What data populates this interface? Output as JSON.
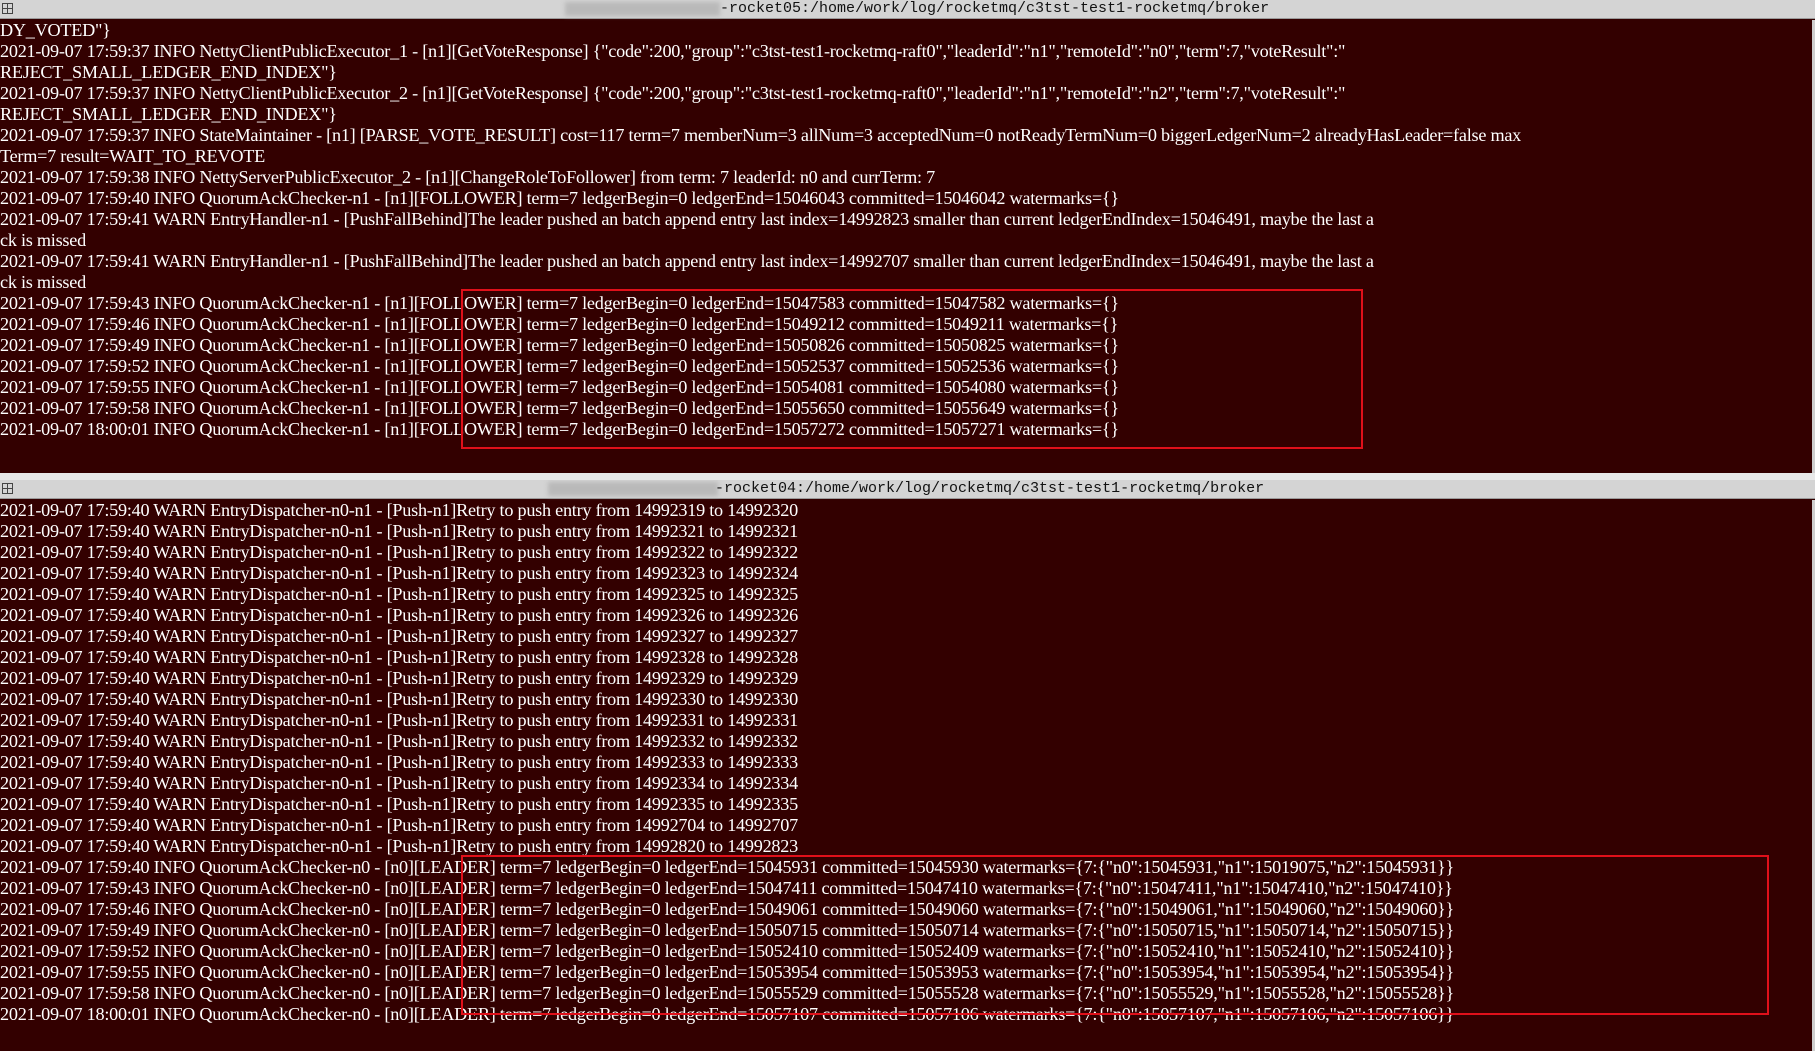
{
  "colors": {
    "background": "#330000",
    "text": "#ffffff",
    "highlight": "#e0101a"
  },
  "top_window": {
    "title_suffix": "-rocket05:/home/work/log/rocketmq/c3tst-test1-rocketmq/broker",
    "lines": [
      "DY_VOTED\"}",
      "2021-09-07 17:59:37 INFO NettyClientPublicExecutor_1 - [n1][GetVoteResponse] {\"code\":200,\"group\":\"c3tst-test1-rocketmq-raft0\",\"leaderId\":\"n1\",\"remoteId\":\"n0\",\"term\":7,\"voteResult\":\"",
      "REJECT_SMALL_LEDGER_END_INDEX\"}",
      "2021-09-07 17:59:37 INFO NettyClientPublicExecutor_2 - [n1][GetVoteResponse] {\"code\":200,\"group\":\"c3tst-test1-rocketmq-raft0\",\"leaderId\":\"n1\",\"remoteId\":\"n2\",\"term\":7,\"voteResult\":\"",
      "REJECT_SMALL_LEDGER_END_INDEX\"}",
      "2021-09-07 17:59:37 INFO StateMaintainer - [n1] [PARSE_VOTE_RESULT] cost=117 term=7 memberNum=3 allNum=3 acceptedNum=0 notReadyTermNum=0 biggerLedgerNum=2 alreadyHasLeader=false max",
      "Term=7 result=WAIT_TO_REVOTE",
      "2021-09-07 17:59:38 INFO NettyServerPublicExecutor_2 - [n1][ChangeRoleToFollower] from term: 7 leaderId: n0 and currTerm: 7",
      "2021-09-07 17:59:40 INFO QuorumAckChecker-n1 - [n1][FOLLOWER] term=7 ledgerBegin=0 ledgerEnd=15046043 committed=15046042 watermarks={}",
      "2021-09-07 17:59:41 WARN EntryHandler-n1 - [PushFallBehind]The leader pushed an batch append entry last index=14992823 smaller than current ledgerEndIndex=15046491, maybe the last a",
      "ck is missed",
      "2021-09-07 17:59:41 WARN EntryHandler-n1 - [PushFallBehind]The leader pushed an batch append entry last index=14992707 smaller than current ledgerEndIndex=15046491, maybe the last a",
      "ck is missed",
      "2021-09-07 17:59:43 INFO QuorumAckChecker-n1 - [n1][FOLLOWER] term=7 ledgerBegin=0 ledgerEnd=15047583 committed=15047582 watermarks={}",
      "2021-09-07 17:59:46 INFO QuorumAckChecker-n1 - [n1][FOLLOWER] term=7 ledgerBegin=0 ledgerEnd=15049212 committed=15049211 watermarks={}",
      "2021-09-07 17:59:49 INFO QuorumAckChecker-n1 - [n1][FOLLOWER] term=7 ledgerBegin=0 ledgerEnd=15050826 committed=15050825 watermarks={}",
      "2021-09-07 17:59:52 INFO QuorumAckChecker-n1 - [n1][FOLLOWER] term=7 ledgerBegin=0 ledgerEnd=15052537 committed=15052536 watermarks={}",
      "2021-09-07 17:59:55 INFO QuorumAckChecker-n1 - [n1][FOLLOWER] term=7 ledgerBegin=0 ledgerEnd=15054081 committed=15054080 watermarks={}",
      "2021-09-07 17:59:58 INFO QuorumAckChecker-n1 - [n1][FOLLOWER] term=7 ledgerBegin=0 ledgerEnd=15055650 committed=15055649 watermarks={}",
      "2021-09-07 18:00:01 INFO QuorumAckChecker-n1 - [n1][FOLLOWER] term=7 ledgerBegin=0 ledgerEnd=15057272 committed=15057271 watermarks={}"
    ]
  },
  "bottom_window": {
    "title_suffix": "-rocket04:/home/work/log/rocketmq/c3tst-test1-rocketmq/broker",
    "lines": [
      "2021-09-07 17:59:40 WARN EntryDispatcher-n0-n1 - [Push-n1]Retry to push entry from 14992319 to 14992320",
      "2021-09-07 17:59:40 WARN EntryDispatcher-n0-n1 - [Push-n1]Retry to push entry from 14992321 to 14992321",
      "2021-09-07 17:59:40 WARN EntryDispatcher-n0-n1 - [Push-n1]Retry to push entry from 14992322 to 14992322",
      "2021-09-07 17:59:40 WARN EntryDispatcher-n0-n1 - [Push-n1]Retry to push entry from 14992323 to 14992324",
      "2021-09-07 17:59:40 WARN EntryDispatcher-n0-n1 - [Push-n1]Retry to push entry from 14992325 to 14992325",
      "2021-09-07 17:59:40 WARN EntryDispatcher-n0-n1 - [Push-n1]Retry to push entry from 14992326 to 14992326",
      "2021-09-07 17:59:40 WARN EntryDispatcher-n0-n1 - [Push-n1]Retry to push entry from 14992327 to 14992327",
      "2021-09-07 17:59:40 WARN EntryDispatcher-n0-n1 - [Push-n1]Retry to push entry from 14992328 to 14992328",
      "2021-09-07 17:59:40 WARN EntryDispatcher-n0-n1 - [Push-n1]Retry to push entry from 14992329 to 14992329",
      "2021-09-07 17:59:40 WARN EntryDispatcher-n0-n1 - [Push-n1]Retry to push entry from 14992330 to 14992330",
      "2021-09-07 17:59:40 WARN EntryDispatcher-n0-n1 - [Push-n1]Retry to push entry from 14992331 to 14992331",
      "2021-09-07 17:59:40 WARN EntryDispatcher-n0-n1 - [Push-n1]Retry to push entry from 14992332 to 14992332",
      "2021-09-07 17:59:40 WARN EntryDispatcher-n0-n1 - [Push-n1]Retry to push entry from 14992333 to 14992333",
      "2021-09-07 17:59:40 WARN EntryDispatcher-n0-n1 - [Push-n1]Retry to push entry from 14992334 to 14992334",
      "2021-09-07 17:59:40 WARN EntryDispatcher-n0-n1 - [Push-n1]Retry to push entry from 14992335 to 14992335",
      "2021-09-07 17:59:40 WARN EntryDispatcher-n0-n1 - [Push-n1]Retry to push entry from 14992704 to 14992707",
      "2021-09-07 17:59:40 WARN EntryDispatcher-n0-n1 - [Push-n1]Retry to push entry from 14992820 to 14992823",
      "2021-09-07 17:59:40 INFO QuorumAckChecker-n0 - [n0][LEADER] term=7 ledgerBegin=0 ledgerEnd=15045931 committed=15045930 watermarks={7:{\"n0\":15045931,\"n1\":15019075,\"n2\":15045931}}",
      "2021-09-07 17:59:43 INFO QuorumAckChecker-n0 - [n0][LEADER] term=7 ledgerBegin=0 ledgerEnd=15047411 committed=15047410 watermarks={7:{\"n0\":15047411,\"n1\":15047410,\"n2\":15047410}}",
      "2021-09-07 17:59:46 INFO QuorumAckChecker-n0 - [n0][LEADER] term=7 ledgerBegin=0 ledgerEnd=15049061 committed=15049060 watermarks={7:{\"n0\":15049061,\"n1\":15049060,\"n2\":15049060}}",
      "2021-09-07 17:59:49 INFO QuorumAckChecker-n0 - [n0][LEADER] term=7 ledgerBegin=0 ledgerEnd=15050715 committed=15050714 watermarks={7:{\"n0\":15050715,\"n1\":15050714,\"n2\":15050715}}",
      "2021-09-07 17:59:52 INFO QuorumAckChecker-n0 - [n0][LEADER] term=7 ledgerBegin=0 ledgerEnd=15052410 committed=15052409 watermarks={7:{\"n0\":15052410,\"n1\":15052410,\"n2\":15052410}}",
      "2021-09-07 17:59:55 INFO QuorumAckChecker-n0 - [n0][LEADER] term=7 ledgerBegin=0 ledgerEnd=15053954 committed=15053953 watermarks={7:{\"n0\":15053954,\"n1\":15053954,\"n2\":15053954}}",
      "2021-09-07 17:59:58 INFO QuorumAckChecker-n0 - [n0][LEADER] term=7 ledgerBegin=0 ledgerEnd=15055529 committed=15055528 watermarks={7:{\"n0\":15055529,\"n1\":15055528,\"n2\":15055528}}",
      "2021-09-07 18:00:01 INFO QuorumAckChecker-n0 - [n0][LEADER] term=7 ledgerBegin=0 ledgerEnd=15057107 committed=15057106 watermarks={7:{\"n0\":15057107,\"n1\":15057106,\"n2\":15057106}}"
    ]
  }
}
